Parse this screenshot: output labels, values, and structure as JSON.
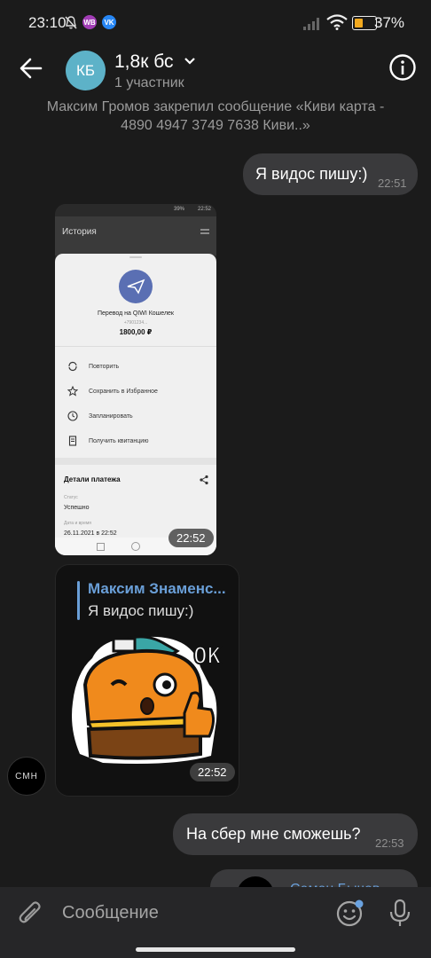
{
  "status_bar": {
    "time": "23:10",
    "app_badges": [
      {
        "name": "wb-icon",
        "text": "WB",
        "color": "#a23db6"
      },
      {
        "name": "vk-icon",
        "text": "VK",
        "color": "#2787f5"
      }
    ],
    "battery_percent": "37%",
    "battery_level": 0.37
  },
  "header": {
    "avatar_initials": "КБ",
    "title": "1,8к бс",
    "subtitle": "1 участник"
  },
  "pinned": {
    "author": "Максим Громов",
    "action": " закрепил сообщение ",
    "text": "«Киви карта - 4890 4947 3749 7638 Киви..»"
  },
  "messages": [
    {
      "text": "Я видос пишу:)",
      "time": "22:51"
    },
    {
      "time": "22:52"
    },
    {
      "reply_author": "Максим Знаменс...",
      "reply_text": "Я видос пишу:)",
      "sticker_text": "OK",
      "time": "22:52",
      "sender_avatar": "СМН"
    },
    {
      "text": "На сбер мне сможешь?",
      "time": "22:53"
    },
    {
      "partial_reply_author": "Семен Бычев"
    }
  ],
  "screenshot": {
    "header_title": "История",
    "status_time": "22:52",
    "status_battery": "39%",
    "recipient_name": "Перевод на QIWI Кошелек",
    "recipient_phone": "+7901234...",
    "amount": "1800,00 ₽",
    "actions": [
      "Повторить",
      "Сохранить в Избранное",
      "Запланировать",
      "Получить квитанцию"
    ],
    "details_title": "Детали платежа",
    "status_label": "Статус",
    "status_value": "Успешно",
    "date_label": "Дата и время",
    "date_value": "26.11.2021 в 22:52"
  },
  "composer": {
    "placeholder": "Сообщение"
  }
}
